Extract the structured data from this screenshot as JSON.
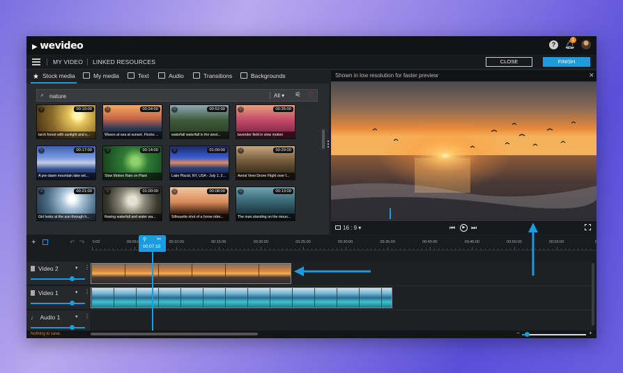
{
  "app": {
    "logo": "wevideo",
    "notification_count": "1",
    "help_label": "?"
  },
  "menubar": {
    "project": "MY VIDEO",
    "linked": "LINKED RESOURCES",
    "close": "CLOSE",
    "finish": "FINISH"
  },
  "tabs": [
    {
      "label": "Stock media",
      "icon": "star-icon"
    },
    {
      "label": "My media",
      "icon": "folder-icon"
    },
    {
      "label": "Text",
      "icon": "text-icon"
    },
    {
      "label": "Audio",
      "icon": "audio-icon"
    },
    {
      "label": "Transitions",
      "icon": "transitions-icon"
    },
    {
      "label": "Backgrounds",
      "icon": "backgrounds-icon"
    }
  ],
  "search": {
    "value": "nature",
    "filter": "All ▾"
  },
  "media": [
    {
      "duration": "00:10:00",
      "caption": "larch forest with sunlight and s..."
    },
    {
      "duration": "00:24:00",
      "caption": "Waves at sea at sunset. Flocks ..."
    },
    {
      "duration": "00:52:00",
      "caption": "waterfall waterfall in the west..."
    },
    {
      "duration": "00:35:00",
      "caption": "lavender field in slow motion"
    },
    {
      "duration": "00:17:00",
      "caption": "A pre-dawn mountain lake wit..."
    },
    {
      "duration": "00:14:00",
      "caption": "Slow Motion Rain on Plant"
    },
    {
      "duration": "01:00:00",
      "caption": "Lake Placid, NY, USA - July 1, 2..."
    },
    {
      "duration": "00:29:00",
      "caption": "Aerial View Drone Flight over f..."
    },
    {
      "duration": "00:21:00",
      "caption": "Girl looks at the sun through h..."
    },
    {
      "duration": "01:00:00",
      "caption": "flowing waterfall and water wa..."
    },
    {
      "duration": "00:08:00",
      "caption": "Silhouette shot of a horse rider..."
    },
    {
      "duration": "00:13:00",
      "caption": "The man standing on the moun..."
    }
  ],
  "preview": {
    "note": "Shown in low resolution for faster preview",
    "aspect": "16 : 9 ▾"
  },
  "timeline": {
    "playhead_time": "00:07:10",
    "ticks": [
      "0:00",
      "00:05:00",
      "00:10:00",
      "00:15:00",
      "00:20:00",
      "00:25:00",
      "00:30:00",
      "00:35:00",
      "00:40:00",
      "00:45:00",
      "00:50:00",
      "00:55:00",
      "01:0"
    ],
    "tracks": [
      {
        "name": "Video 2"
      },
      {
        "name": "Video 1"
      },
      {
        "name": "Audio 1"
      }
    ],
    "status": "Nothing to save."
  },
  "colors": {
    "accent": "#1b9be0",
    "favorite": "#e0463a",
    "status_text": "#d9822b"
  }
}
